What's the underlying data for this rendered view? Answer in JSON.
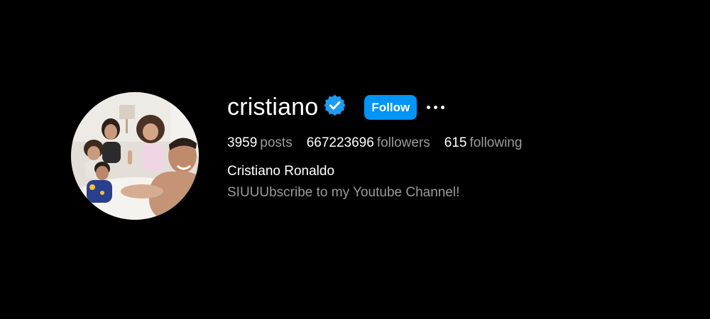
{
  "profile": {
    "username": "cristiano",
    "verified_icon": "verified-badge-icon",
    "follow_label": "Follow",
    "more_icon": "more-options-icon",
    "full_name": "Cristiano Ronaldo",
    "bio": "SIUUUbscribe to my Youtube Channel!"
  },
  "stats": {
    "posts_count": "3959",
    "posts_label": "posts",
    "followers_count": "667223696",
    "followers_label": "followers",
    "following_count": "615",
    "following_label": "following"
  },
  "colors": {
    "background": "#000000",
    "accent": "#0095f6",
    "muted_text": "#9a9a9a"
  }
}
